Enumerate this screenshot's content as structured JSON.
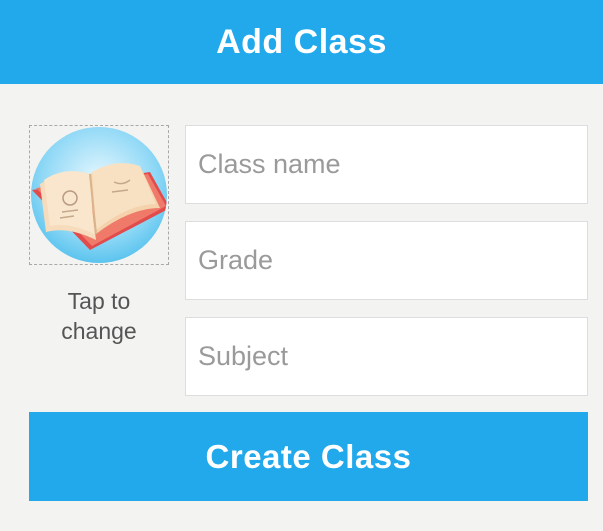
{
  "header": {
    "title": "Add Class"
  },
  "avatar": {
    "icon": "open-book-icon",
    "caption": "Tap to change"
  },
  "form": {
    "class_name": {
      "placeholder": "Class name",
      "value": ""
    },
    "grade": {
      "placeholder": "Grade",
      "value": ""
    },
    "subject": {
      "placeholder": "Subject",
      "value": ""
    }
  },
  "actions": {
    "create_label": "Create Class"
  },
  "colors": {
    "accent": "#22a9ec",
    "background": "#f3f3f1",
    "field_bg": "#ffffff"
  }
}
